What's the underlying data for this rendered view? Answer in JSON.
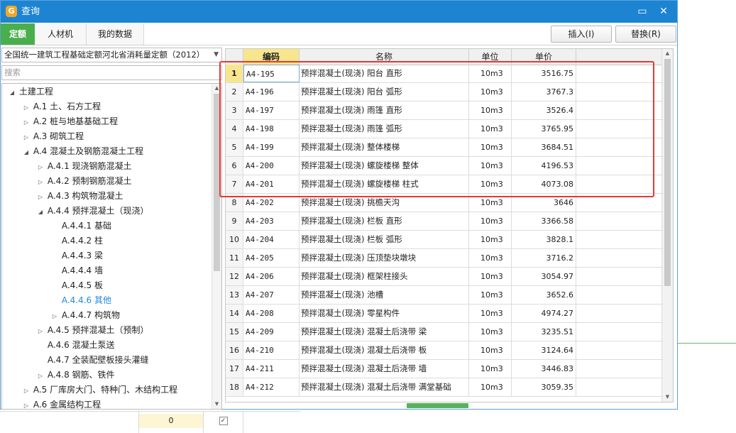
{
  "window": {
    "title": "查询",
    "minimize_glyph": "▭",
    "close_glyph": "✕",
    "logo_glyph": "G"
  },
  "tabs": [
    {
      "label": "定额",
      "active": true
    },
    {
      "label": "人材机",
      "active": false
    },
    {
      "label": "我的数据",
      "active": false
    }
  ],
  "actions": {
    "insert": "插入(I)",
    "replace": "替换(R)"
  },
  "quota_library": {
    "selected": "全国统一建筑工程基础定额河北省消耗量定额（2012）"
  },
  "search": {
    "placeholder": "搜索"
  },
  "tree": [
    {
      "label": "土建工程",
      "level": 0,
      "state": "expanded"
    },
    {
      "label": "A.1 土、石方工程",
      "level": 1,
      "state": "collapsed"
    },
    {
      "label": "A.2 桩与地基基础工程",
      "level": 1,
      "state": "collapsed"
    },
    {
      "label": "A.3 砌筑工程",
      "level": 1,
      "state": "collapsed"
    },
    {
      "label": "A.4 混凝土及钢筋混凝土工程",
      "level": 1,
      "state": "expanded"
    },
    {
      "label": "A.4.1 现浇钢筋混凝土",
      "level": 2,
      "state": "collapsed"
    },
    {
      "label": "A.4.2 预制钢筋混凝土",
      "level": 2,
      "state": "collapsed"
    },
    {
      "label": "A.4.3 构筑物混凝土",
      "level": 2,
      "state": "collapsed"
    },
    {
      "label": "A.4.4 预拌混凝土（现浇）",
      "level": 2,
      "state": "expanded"
    },
    {
      "label": "A.4.4.1 基础",
      "level": 3,
      "state": "leaf"
    },
    {
      "label": "A.4.4.2 柱",
      "level": 3,
      "state": "leaf"
    },
    {
      "label": "A.4.4.3 梁",
      "level": 3,
      "state": "leaf"
    },
    {
      "label": "A.4.4.4 墙",
      "level": 3,
      "state": "leaf"
    },
    {
      "label": "A.4.4.5 板",
      "level": 3,
      "state": "leaf"
    },
    {
      "label": "A.4.4.6 其他",
      "level": 3,
      "state": "leaf",
      "selected": true
    },
    {
      "label": "A.4.4.7 构筑物",
      "level": 3,
      "state": "collapsed"
    },
    {
      "label": "A.4.5 预拌混凝土（预制）",
      "level": 2,
      "state": "collapsed"
    },
    {
      "label": "A.4.6 混凝土泵送",
      "level": 2,
      "state": "leaf"
    },
    {
      "label": "A.4.7 全装配壁板接头灌缝",
      "level": 2,
      "state": "leaf"
    },
    {
      "label": "A.4.8 钢筋、铁件",
      "level": 2,
      "state": "collapsed"
    },
    {
      "label": "A.5 厂库房大门、特种门、木结构工程",
      "level": 1,
      "state": "collapsed"
    },
    {
      "label": "A.6 金属结构工程",
      "level": 1,
      "state": "collapsed"
    }
  ],
  "grid": {
    "headers": {
      "code": "编码",
      "name": "名称",
      "unit": "单位",
      "price": "单价"
    },
    "rows": [
      {
        "idx": "1",
        "code": "A4-195",
        "name": "预拌混凝土(现浇) 阳台 直形",
        "unit": "10m3",
        "price": "3516.75"
      },
      {
        "idx": "2",
        "code": "A4-196",
        "name": "预拌混凝土(现浇) 阳台 弧形",
        "unit": "10m3",
        "price": "3767.3"
      },
      {
        "idx": "3",
        "code": "A4-197",
        "name": "预拌混凝土(现浇) 雨篷 直形",
        "unit": "10m3",
        "price": "3526.4"
      },
      {
        "idx": "4",
        "code": "A4-198",
        "name": "预拌混凝土(现浇) 雨篷 弧形",
        "unit": "10m3",
        "price": "3765.95"
      },
      {
        "idx": "5",
        "code": "A4-199",
        "name": "预拌混凝土(现浇) 整体楼梯",
        "unit": "10m3",
        "price": "3684.51"
      },
      {
        "idx": "6",
        "code": "A4-200",
        "name": "预拌混凝土(现浇) 螺旋楼梯 整体",
        "unit": "10m3",
        "price": "4196.53"
      },
      {
        "idx": "7",
        "code": "A4-201",
        "name": "预拌混凝土(现浇) 螺旋楼梯 柱式",
        "unit": "10m3",
        "price": "4073.08"
      },
      {
        "idx": "8",
        "code": "A4-202",
        "name": "预拌混凝土(现浇) 挑檐天沟",
        "unit": "10m3",
        "price": "3646"
      },
      {
        "idx": "9",
        "code": "A4-203",
        "name": "预拌混凝土(现浇) 栏板 直形",
        "unit": "10m3",
        "price": "3366.58"
      },
      {
        "idx": "10",
        "code": "A4-204",
        "name": "预拌混凝土(现浇) 栏板 弧形",
        "unit": "10m3",
        "price": "3828.1"
      },
      {
        "idx": "11",
        "code": "A4-205",
        "name": "预拌混凝土(现浇) 压顶垫块墩块",
        "unit": "10m3",
        "price": "3716.2"
      },
      {
        "idx": "12",
        "code": "A4-206",
        "name": "预拌混凝土(现浇) 框架柱接头",
        "unit": "10m3",
        "price": "3054.97"
      },
      {
        "idx": "13",
        "code": "A4-207",
        "name": "预拌混凝土(现浇) 池槽",
        "unit": "10m3",
        "price": "3652.6"
      },
      {
        "idx": "14",
        "code": "A4-208",
        "name": "预拌混凝土(现浇) 零星构件",
        "unit": "10m3",
        "price": "4974.27"
      },
      {
        "idx": "15",
        "code": "A4-209",
        "name": "预拌混凝土(现浇) 混凝土后浇带 梁",
        "unit": "10m3",
        "price": "3235.51"
      },
      {
        "idx": "16",
        "code": "A4-210",
        "name": "预拌混凝土(现浇) 混凝土后浇带 板",
        "unit": "10m3",
        "price": "3124.64"
      },
      {
        "idx": "17",
        "code": "A4-211",
        "name": "预拌混凝土(现浇) 混凝土后浇带 墙",
        "unit": "10m3",
        "price": "3446.83"
      },
      {
        "idx": "18",
        "code": "A4-212",
        "name": "预拌混凝土(现浇) 混凝土后浇带 满堂基础",
        "unit": "10m3",
        "price": "3059.35"
      }
    ]
  },
  "underlay": {
    "value": "0",
    "check": "✓"
  },
  "colors": {
    "titlebar": "#1d84d2",
    "active_tab": "#4aae4e",
    "header_code": "#f8e68f",
    "highlight_box": "#e53935",
    "selected_tree": "#1f8ae0"
  }
}
